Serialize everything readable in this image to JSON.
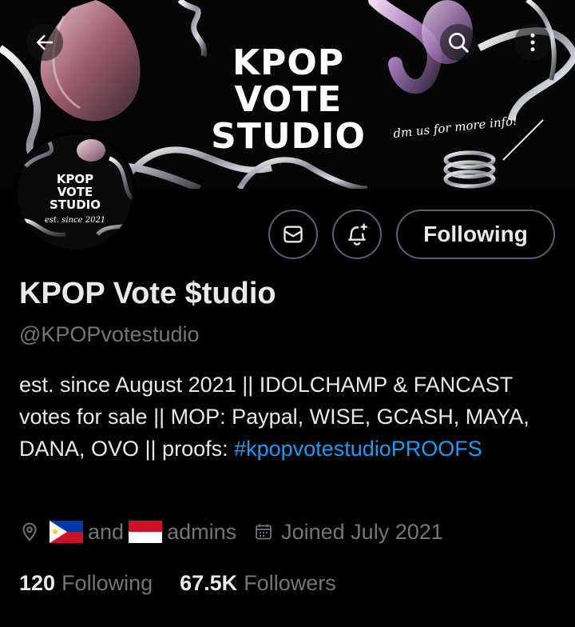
{
  "banner": {
    "title_lines": [
      "KPOP",
      "VOTE",
      "STUDIO"
    ],
    "tagline": "dm us for more info!"
  },
  "avatar": {
    "title_lines": [
      "KPOP",
      "VOTE",
      "STUDIO"
    ],
    "subtitle": "est. since 2021"
  },
  "header": {
    "icons": {
      "back": "arrow-left-icon",
      "search": "search-icon",
      "more": "more-vertical-icon"
    }
  },
  "actions": {
    "message_icon": "envelope-icon",
    "notify_icon": "bell-plus-icon",
    "following_label": "Following"
  },
  "profile": {
    "name": "KPOP Vote $tudio",
    "handle": "@KPOPvotestudio",
    "bio": {
      "text": "est. since August 2021 || IDOLCHAMP & FANCAST votes for sale  || MOP: Paypal, WISE, GCASH, MAYA, DANA, OVO || proofs: ",
      "hashtag": "#kpopvotestudioPROOFS"
    },
    "location": {
      "icon": "location-pin-icon",
      "flag1": "philippines-flag",
      "and_text": "and",
      "flag2": "indonesia-flag",
      "suffix": "admins"
    },
    "joined": {
      "icon": "calendar-icon",
      "text": "Joined July 2021"
    },
    "stats": {
      "following_count": "120",
      "following_label": "Following",
      "followers_count": "67.5K",
      "followers_label": "Followers"
    }
  },
  "colors": {
    "background": "#000000",
    "text_primary": "#e7e9ea",
    "text_secondary": "#71767b",
    "accent": "#1d9bf0",
    "border": "#536471"
  }
}
